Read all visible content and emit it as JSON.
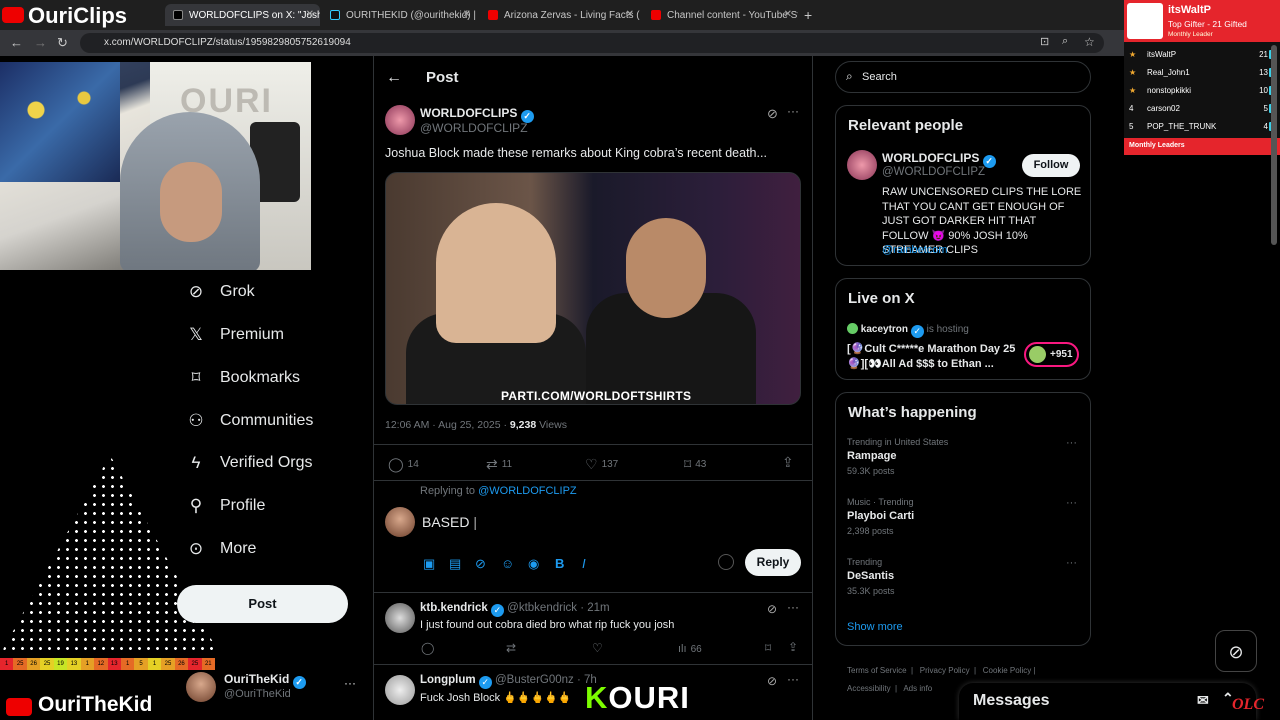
{
  "browser": {
    "tabs": [
      {
        "title": "WORLDOFCLIPS on X: \"Josh"
      },
      {
        "title": "OURITHEKID (@ourithekid) | Ti"
      },
      {
        "title": "Arizona Zervas - Living Facts (P"
      },
      {
        "title": "Channel content - YouTube Stu"
      }
    ],
    "url": "x.com/WORLDOFCLIPZ/status/1959829805752619094"
  },
  "stream": {
    "logo_top": "OuriClips",
    "logo_bottom": "OuriTheKid",
    "webcam_sign": "OURI",
    "color_bar": [
      "1",
      "25",
      "26",
      "25",
      "19",
      "13",
      "1",
      "12",
      "13",
      "1",
      "5",
      "1",
      "25",
      "26",
      "25",
      "21"
    ],
    "kouri": {
      "k": "K",
      "rest": "OURI"
    },
    "olc": "OLC",
    "leaderboard": {
      "top_name": "itsWaltP",
      "top_desc": "Top Gifter - 21 Gifted",
      "top_sub": "Monthly Leader",
      "rows": [
        {
          "rank": "★",
          "name": "itsWaltP",
          "count": "21"
        },
        {
          "rank": "★",
          "name": "Real_John1",
          "count": "13"
        },
        {
          "rank": "★",
          "name": "nonstopkikki",
          "count": "10"
        },
        {
          "rank": "4",
          "name": "carson02",
          "count": "5"
        },
        {
          "rank": "5",
          "name": "POP_THE_TRUNK",
          "count": "4"
        }
      ],
      "footer": "Monthly Leaders"
    }
  },
  "nav": {
    "items": [
      {
        "label": "Grok",
        "icon": "grok-icon",
        "glyph": "⊘"
      },
      {
        "label": "Premium",
        "icon": "x-logo-icon",
        "glyph": "𝕏"
      },
      {
        "label": "Bookmarks",
        "icon": "bookmark-icon",
        "glyph": "⌑"
      },
      {
        "label": "Communities",
        "icon": "communities-icon",
        "glyph": "⚇"
      },
      {
        "label": "Verified Orgs",
        "icon": "lightning-icon",
        "glyph": "ϟ"
      },
      {
        "label": "Profile",
        "icon": "person-icon",
        "glyph": "⚲"
      },
      {
        "label": "More",
        "icon": "more-icon",
        "glyph": "⊙"
      }
    ],
    "post_button": "Post",
    "account": {
      "name": "OuriTheKid",
      "handle": "@OuriTheKid"
    }
  },
  "post": {
    "header": "Post",
    "author": "WORLDOFCLIPS",
    "handle": "@WORLDOFCLIPZ",
    "text": "Joshua Block made these remarks about King cobra’s recent death...",
    "media_watermark": "PARTI.COM/WORLDOFTSHIRTS",
    "time": "12:06 AM · Aug 25, 2025 · ",
    "views_count": "9,238",
    "views_label": " Views",
    "stats": {
      "replies": "14",
      "reposts": "11",
      "likes": "137",
      "bookmarks": "43"
    }
  },
  "reply_box": {
    "replying_prefix": "Replying to ",
    "replying_to": "@WORLDOFCLIPZ",
    "draft": "BASED",
    "reply_button": "Reply"
  },
  "replies": [
    {
      "name": "ktb.kendrick",
      "handle": "@ktbkendrick · 21m",
      "text": "I just found out cobra died bro what rip fuck you josh",
      "views": "66"
    },
    {
      "name": "Longplum",
      "handle": "@BusterG00nz · 7h",
      "text": "Fuck Josh Block 🖕🖕🖕🖕🖕"
    }
  ],
  "sidebar": {
    "search_placeholder": "Search",
    "relevant": {
      "title": "Relevant people",
      "name": "WORLDOFCLIPS",
      "handle": "@WORLDOFCLIPZ",
      "follow": "Follow",
      "bio": "RAW UNCENSORED CLIPS THE LORE THAT YOU CANT GET ENOUGH OF JUST GOT DARKER HIT THAT FOLLOW 😈 90% JOSH 10% STREAMER CLIPS",
      "link": "@rainbetcom"
    },
    "live": {
      "title": "Live on X",
      "host": "kaceytron",
      "hosting": "is hosting",
      "stream_title": "[🔮Cult C*****e Marathon Day 25🔮][👀All Ad $$$ to Ethan ...",
      "viewers": "+951"
    },
    "happening": {
      "title": "What’s happening",
      "trends": [
        {
          "category": "Trending in United States",
          "name": "Rampage",
          "count": "59.3K posts"
        },
        {
          "category": "Music · Trending",
          "name": "Playboi Carti",
          "count": "2,398 posts"
        },
        {
          "category": "Trending",
          "name": "DeSantis",
          "count": "35.3K posts"
        }
      ],
      "show_more": "Show more"
    },
    "footer": [
      "Terms of Service",
      "Privacy Policy",
      "Cookie Policy",
      "Accessibility",
      "Ads info"
    ],
    "messages": "Messages"
  },
  "colors": {
    "accent": "#1d9bf0",
    "bg": "#000000",
    "border": "#2f3336",
    "stream_red": "#e5252c"
  }
}
